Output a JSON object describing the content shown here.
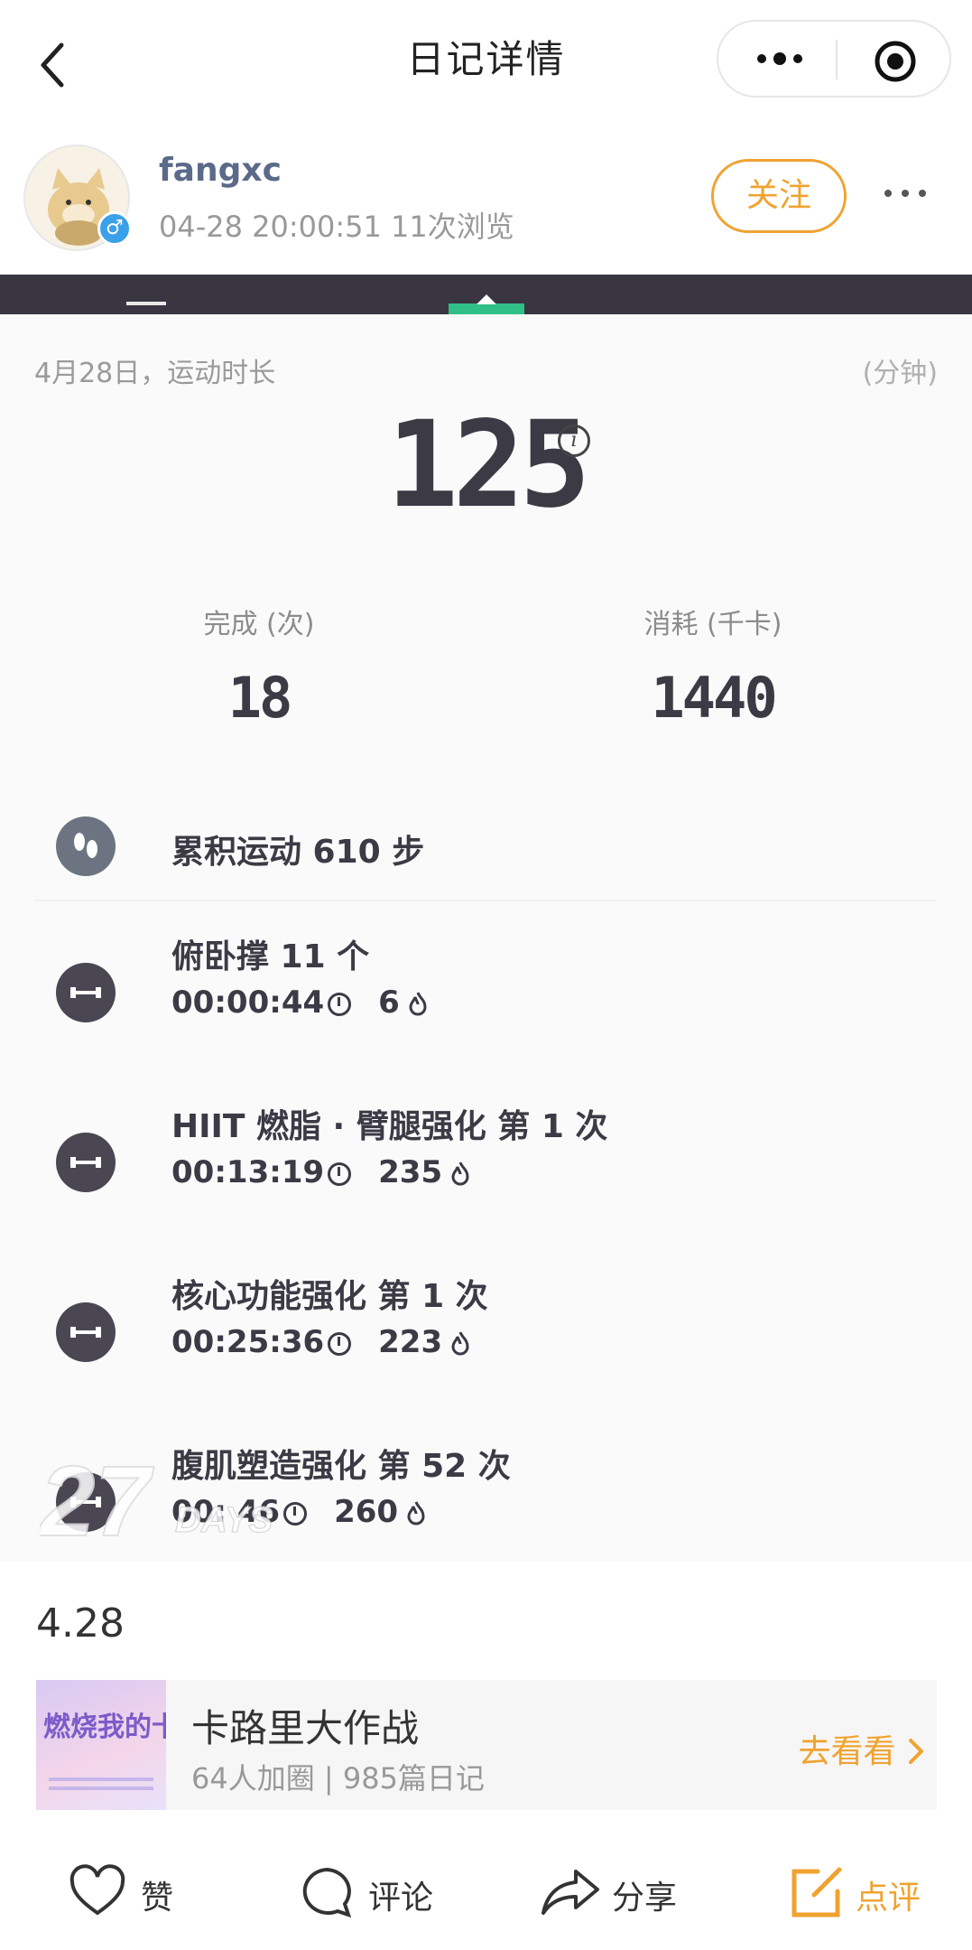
{
  "nav": {
    "title": "日记详情",
    "back_icon": "chevron-left-icon",
    "more_icon": "more-dots-icon",
    "target_icon": "target-icon"
  },
  "user": {
    "name": "fangxc",
    "meta": "04-28 20:00:51  11次浏览",
    "follow_label": "关注",
    "gender_symbol": "♂"
  },
  "summary": {
    "header": "4月28日，运动时长",
    "unit": "(分钟)",
    "duration": "125",
    "info_symbol": "i",
    "completed_label": "完成 (次)",
    "completed_value": "18",
    "calories_label": "消耗 (千卡)",
    "calories_value": "1440"
  },
  "activities": [
    {
      "name": "累积运动 610 步",
      "time": "",
      "cal": "",
      "icon": "footsteps-icon"
    },
    {
      "name": "俯卧撑 11 个",
      "time": "00:00:44",
      "cal": "6",
      "icon": "dumbbell-icon"
    },
    {
      "name": "HIIT 燃脂 · 臂腿强化  第 1 次",
      "time": "00:13:19",
      "cal": "235",
      "icon": "dumbbell-icon"
    },
    {
      "name": "核心功能强化  第 1 次",
      "time": "00:25:36",
      "cal": "223",
      "icon": "dumbbell-icon"
    },
    {
      "name": "腹肌塑造强化  第 52 次",
      "time": "00:  46",
      "cal": "260",
      "icon": "dumbbell-icon"
    }
  ],
  "watermark": {
    "number": "27",
    "text": "DAYS"
  },
  "date_text": "4.28",
  "group": {
    "name": "卡路里大作战",
    "meta": "64人加圈 | 985篇日记",
    "go_label": "去看看",
    "thumb_text": "燃烧我的卡路里"
  },
  "bottom": {
    "like_label": "赞",
    "comment_label": "评论",
    "share_label": "分享",
    "review_label": "点评"
  },
  "colors": {
    "accent": "#f0a330",
    "dark": "#3b3a45",
    "teal": "#2fbf87",
    "username": "#5b6a8a"
  }
}
